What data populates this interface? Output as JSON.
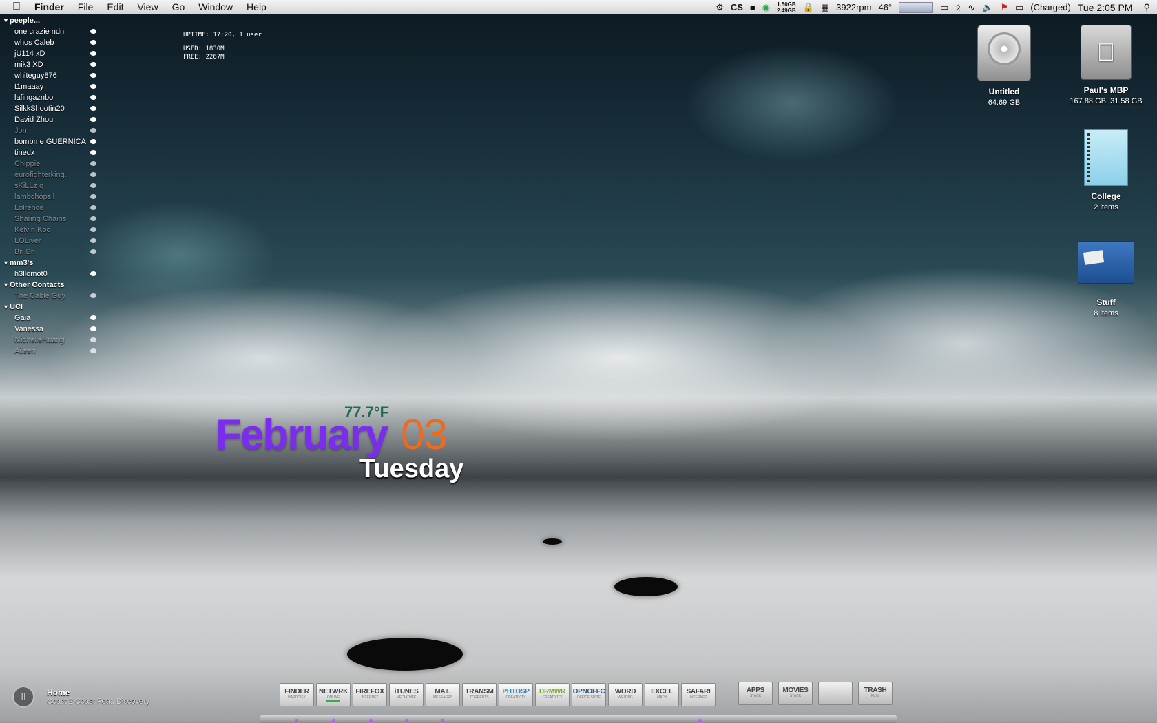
{
  "menubar": {
    "app": "Finder",
    "items": [
      "File",
      "Edit",
      "View",
      "Go",
      "Window",
      "Help"
    ],
    "mem_top": "1.50GB",
    "mem_bottom": "2.49GB",
    "fan": "3922rpm",
    "temp": "46°",
    "battery": "(Charged)",
    "clock": "Tue 2:05 PM"
  },
  "buddies": {
    "groups": [
      {
        "name": "peeple...",
        "items": [
          {
            "name": "one crazie ndn",
            "idle": false
          },
          {
            "name": "whos Caleb",
            "idle": false
          },
          {
            "name": "jU114 xD",
            "idle": false
          },
          {
            "name": "mik3 XD",
            "idle": false
          },
          {
            "name": "whiteguy876",
            "idle": false
          },
          {
            "name": "t1maaay",
            "idle": false
          },
          {
            "name": "lafingaznboi",
            "idle": false
          },
          {
            "name": "SilkkShootin20",
            "idle": false
          },
          {
            "name": "David Zhou",
            "idle": false
          },
          {
            "name": "Jon",
            "idle": true
          },
          {
            "name": "bombme  GUERNICA",
            "idle": false
          },
          {
            "name": "tinedx",
            "idle": false
          },
          {
            "name": "Chippie",
            "idle": true
          },
          {
            "name": "eurofighterking.",
            "idle": true
          },
          {
            "name": "sKiLLz q",
            "idle": true
          },
          {
            "name": "lambchopsil",
            "idle": true
          },
          {
            "name": "Lolrence",
            "idle": true
          },
          {
            "name": "Sharing Chains",
            "idle": true
          },
          {
            "name": "Kelvin Koo",
            "idle": true
          },
          {
            "name": "LOLiver",
            "idle": true
          },
          {
            "name": "Bri Bri",
            "idle": true
          }
        ]
      },
      {
        "name": "mm3's",
        "items": [
          {
            "name": "h3llomot0",
            "idle": false
          }
        ]
      },
      {
        "name": "Other Contacts",
        "items": [
          {
            "name": "The Cable Guy",
            "idle": true
          }
        ]
      },
      {
        "name": "UCI",
        "items": [
          {
            "name": "Gaia",
            "idle": false
          },
          {
            "name": "Vanessa",
            "idle": false
          },
          {
            "name": "MichelleHuang",
            "idle": true
          },
          {
            "name": "Aileen",
            "idle": true
          }
        ]
      }
    ]
  },
  "stats": {
    "uptime": "UPTIME: 17:20, 1 user",
    "used": "USED: 1830M",
    "free": "FREE: 2267M"
  },
  "datewidget": {
    "temp": "77.7°F",
    "month": "February",
    "day": "03",
    "weekday": "Tuesday"
  },
  "desktop_icons": [
    {
      "name": "Untitled",
      "sub": "64.69 GB",
      "icon": "hard-drive-icon"
    },
    {
      "name": "Paul's MBP",
      "sub": "167.88 GB, 31.58 GB",
      "icon": "laptop-drive-icon"
    },
    {
      "name": "College",
      "sub": "2 items",
      "icon": "notebook-icon"
    },
    {
      "name": "Stuff",
      "sub": "8 items",
      "icon": "folder-icon"
    }
  ],
  "nowplaying": {
    "title": "Home",
    "artist": "Coast 2 Coast Feat. Discovery",
    "control": "II"
  },
  "dock": [
    {
      "l1": "FINDER",
      "l2": "HARDDISK",
      "color": "#444"
    },
    {
      "l1": "NETWRK",
      "l2": "ONLINE",
      "color": "#444",
      "bar": "#3aa84a"
    },
    {
      "l1": "FIREFOX",
      "l2": "INTERNET",
      "color": "#444"
    },
    {
      "l1": "iTUNES",
      "l2": "MEDIATHEK",
      "color": "#444"
    },
    {
      "l1": "MAIL",
      "l2": "MESSAGES",
      "color": "#444"
    },
    {
      "l1": "TRANSM",
      "l2": "TORRENTS",
      "color": "#444"
    },
    {
      "l1": "PHTOSP",
      "l2": "CREATIVITY",
      "color": "#2a8ad0"
    },
    {
      "l1": "DRMWR",
      "l2": "CREATIVITY",
      "color": "#7cae2a"
    },
    {
      "l1": "OPNOFFC",
      "l2": "OFFICE SUITE",
      "color": "#3a5a8a"
    },
    {
      "l1": "WORD",
      "l2": "WRITING",
      "color": "#444"
    },
    {
      "l1": "EXCEL",
      "l2": "MATH",
      "color": "#444"
    },
    {
      "l1": "SAFARI",
      "l2": "INTERNET",
      "color": "#444"
    }
  ],
  "dock_right": [
    {
      "l1": "APPS",
      "l2": "STACK"
    },
    {
      "l1": "MOVIES",
      "l2": "STACK"
    },
    {
      "l1": "",
      "l2": ""
    },
    {
      "l1": "TRASH",
      "l2": "FULL"
    }
  ]
}
